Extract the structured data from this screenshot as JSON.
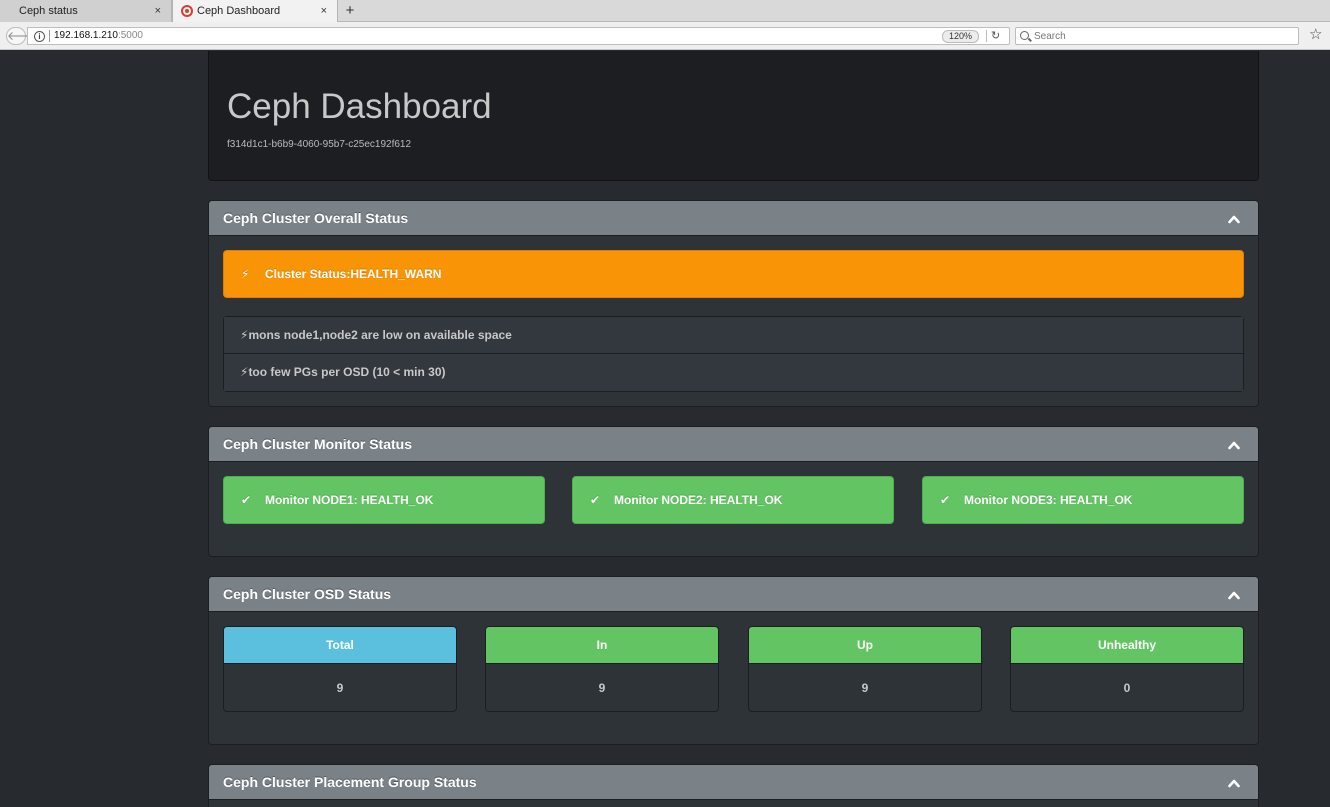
{
  "browser": {
    "tabs": [
      {
        "title": "Ceph status",
        "close": "×"
      },
      {
        "title": "Ceph Dashboard",
        "close": "×"
      }
    ],
    "new_tab": "+",
    "url_host": "192.168.1.210",
    "url_port": ":5000",
    "zoom": "120%",
    "search_placeholder": "Search",
    "bookmark_icon": "star-icon"
  },
  "header": {
    "title": "Ceph Dashboard",
    "cluster_id": "f314d1c1-b6b9-4060-95b7-c25ec192f612"
  },
  "overall": {
    "title": "Ceph Cluster Overall Status",
    "status_label": "Cluster Status:HEALTH_WARN",
    "status_color": "#f89406",
    "messages": [
      "mons node1,node2 are low on available space",
      "too few PGs per OSD (10 < min 30)"
    ]
  },
  "monitors": {
    "title": "Ceph Cluster Monitor Status",
    "ok_color": "#62c462",
    "items": [
      "Monitor NODE1: HEALTH_OK",
      "Monitor NODE2: HEALTH_OK",
      "Monitor NODE3: HEALTH_OK"
    ]
  },
  "osd": {
    "title": "Ceph Cluster OSD Status",
    "boxes": [
      {
        "label": "Total",
        "value": "9",
        "color": "#5bc0de"
      },
      {
        "label": "In",
        "value": "9",
        "color": "#62c462"
      },
      {
        "label": "Up",
        "value": "9",
        "color": "#62c462"
      },
      {
        "label": "Unhealthy",
        "value": "0",
        "color": "#62c462"
      }
    ]
  },
  "pg": {
    "title": "Ceph Cluster Placement Group Status"
  },
  "icons": {
    "warning": "⚡",
    "check": "✔"
  }
}
